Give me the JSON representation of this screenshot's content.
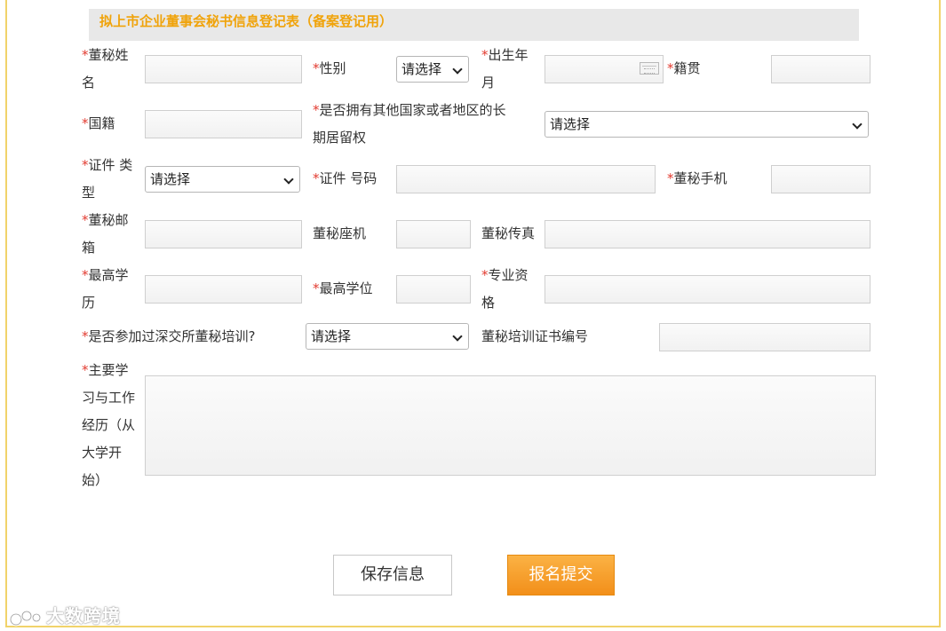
{
  "title": "拟上市企业董事会秘书信息登记表（备案登记用）",
  "required_mark": "*",
  "fields": {
    "name": {
      "label_1": "董秘姓",
      "label_2": "名",
      "value": ""
    },
    "gender": {
      "label": "性别",
      "selected": "请选择"
    },
    "birth": {
      "label_1": "出生年",
      "label_2": "月",
      "value": ""
    },
    "native_place": {
      "label": "籍贯",
      "value": ""
    },
    "nationality": {
      "label": "国籍",
      "value": ""
    },
    "residency": {
      "label_1": "是否拥有其他国家或者地区的长",
      "label_2": "期居留权",
      "selected": "请选择"
    },
    "id_type": {
      "label_1": "证件 类",
      "label_2": "型",
      "selected": "请选择"
    },
    "id_number": {
      "label": "证件 号码",
      "value": ""
    },
    "mobile": {
      "label": "董秘手机",
      "value": ""
    },
    "email": {
      "label_1": "董秘邮",
      "label_2": "箱",
      "value": ""
    },
    "landline": {
      "label": "董秘座机",
      "value": ""
    },
    "fax": {
      "label": "董秘传真",
      "value": ""
    },
    "education": {
      "label_1": "最高学",
      "label_2": "历",
      "value": ""
    },
    "degree": {
      "label": "最高学位",
      "value": ""
    },
    "qualification": {
      "label_1": "专业资",
      "label_2": "格",
      "value": ""
    },
    "training": {
      "label": "是否参加过深交所董秘培训?",
      "selected": "请选择"
    },
    "cert_number": {
      "label": "董秘培训证书编号",
      "value": ""
    },
    "history": {
      "label_1": "主要学",
      "label_2": "习与工作",
      "label_3": "经历（从",
      "label_4": "大学开",
      "label_5": "始）",
      "value": ""
    }
  },
  "buttons": {
    "save": "保存信息",
    "submit": "报名提交"
  },
  "watermark": "大数跨境",
  "colors": {
    "title": "#f0a30a",
    "required": "#e23a2f",
    "submit_bg": "#f5a02a",
    "frame": "#f1d36a"
  }
}
